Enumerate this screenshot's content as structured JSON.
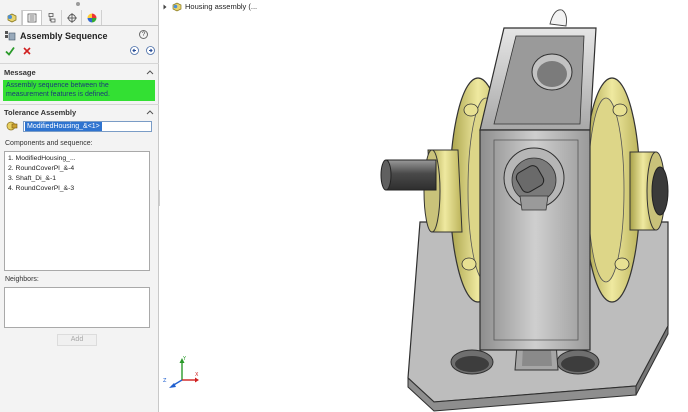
{
  "panel": {
    "title": "Assembly Sequence",
    "help": "?",
    "tabs": [
      "feature-manager-tab",
      "property-manager-tab",
      "configuration-manager-tab",
      "dimxpert-manager-tab",
      "display-manager-tab"
    ],
    "message": {
      "header": "Message",
      "text": "Assembly sequence between the measurement features is defined."
    },
    "tolerance_assembly": {
      "header": "Tolerance Assembly",
      "selected": "ModifiedHousing_&<1>"
    },
    "components": {
      "label": "Components and sequence:",
      "items": [
        "1. ModifiedHousing_...",
        "2. RoundCoverPl_&-4",
        "3. Shaft_Di_&-1",
        "4. RoundCoverPl_&-3"
      ]
    },
    "neighbors": {
      "label": "Neighbors:"
    },
    "add_button": "Add"
  },
  "viewport": {
    "tree_item": "Housing assembly (..."
  },
  "triad": {
    "x": "X",
    "y": "Y",
    "z": "Z"
  },
  "colors": {
    "message_bg": "#33e033",
    "selection": "#2f74d0",
    "cover_yellow": "#e6e08a",
    "housing_gray": "#c8c8c8"
  }
}
